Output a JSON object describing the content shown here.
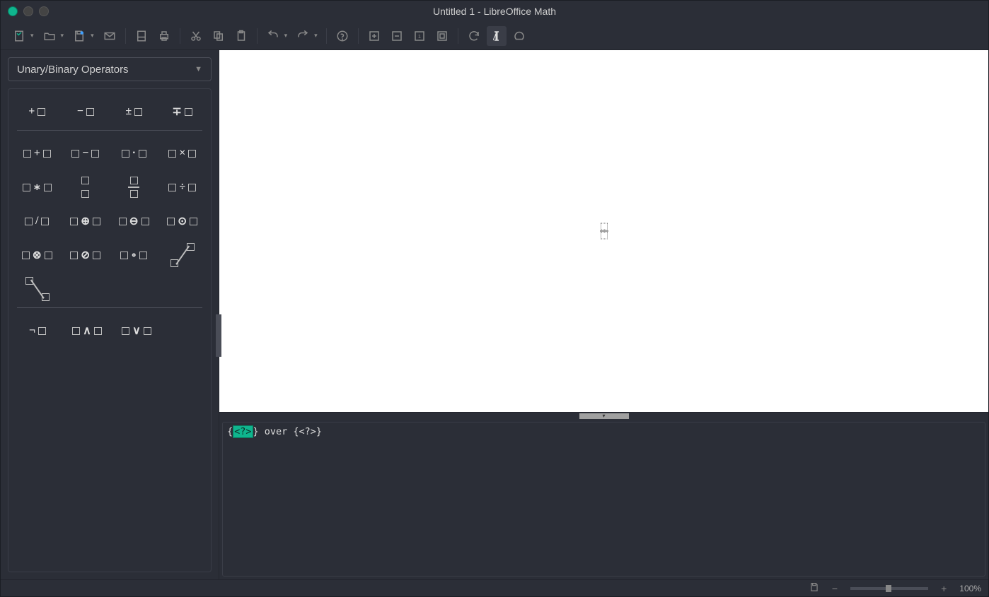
{
  "window": {
    "title": "Untitled 1 - LibreOffice Math"
  },
  "toolbar": {},
  "sidebar": {
    "category": "Unary/Binary Operators"
  },
  "editor": {
    "prefix": "{",
    "selected": "<?>",
    "suffix": "} over {<?>}"
  },
  "status": {
    "zoom": "100%"
  }
}
